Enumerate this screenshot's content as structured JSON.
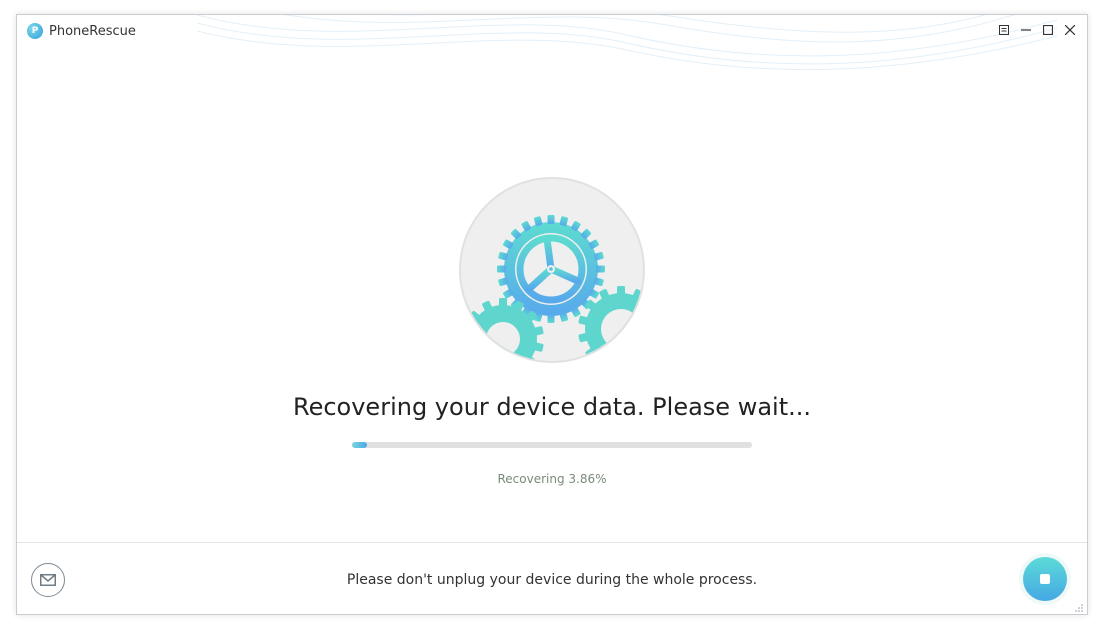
{
  "app": {
    "title": "PhoneRescue"
  },
  "titlebar": {
    "menu_icon": "menu-icon",
    "minimize_icon": "minimize-icon",
    "maximize_icon": "maximize-icon",
    "close_icon": "close-icon"
  },
  "main": {
    "illustration": "gears-icon",
    "headline": "Recovering your device data. Please wait...",
    "progress": {
      "value_percent": 3.86
    },
    "status": "Recovering 3.86%"
  },
  "footer": {
    "notice": "Please don't unplug your device during the whole process.",
    "mail_icon": "mail-icon",
    "stop_icon": "stop-icon"
  },
  "colors": {
    "accent_teal": "#5cdbd8",
    "accent_blue": "#45a8e4",
    "gear_blue": "#5fbde7"
  }
}
